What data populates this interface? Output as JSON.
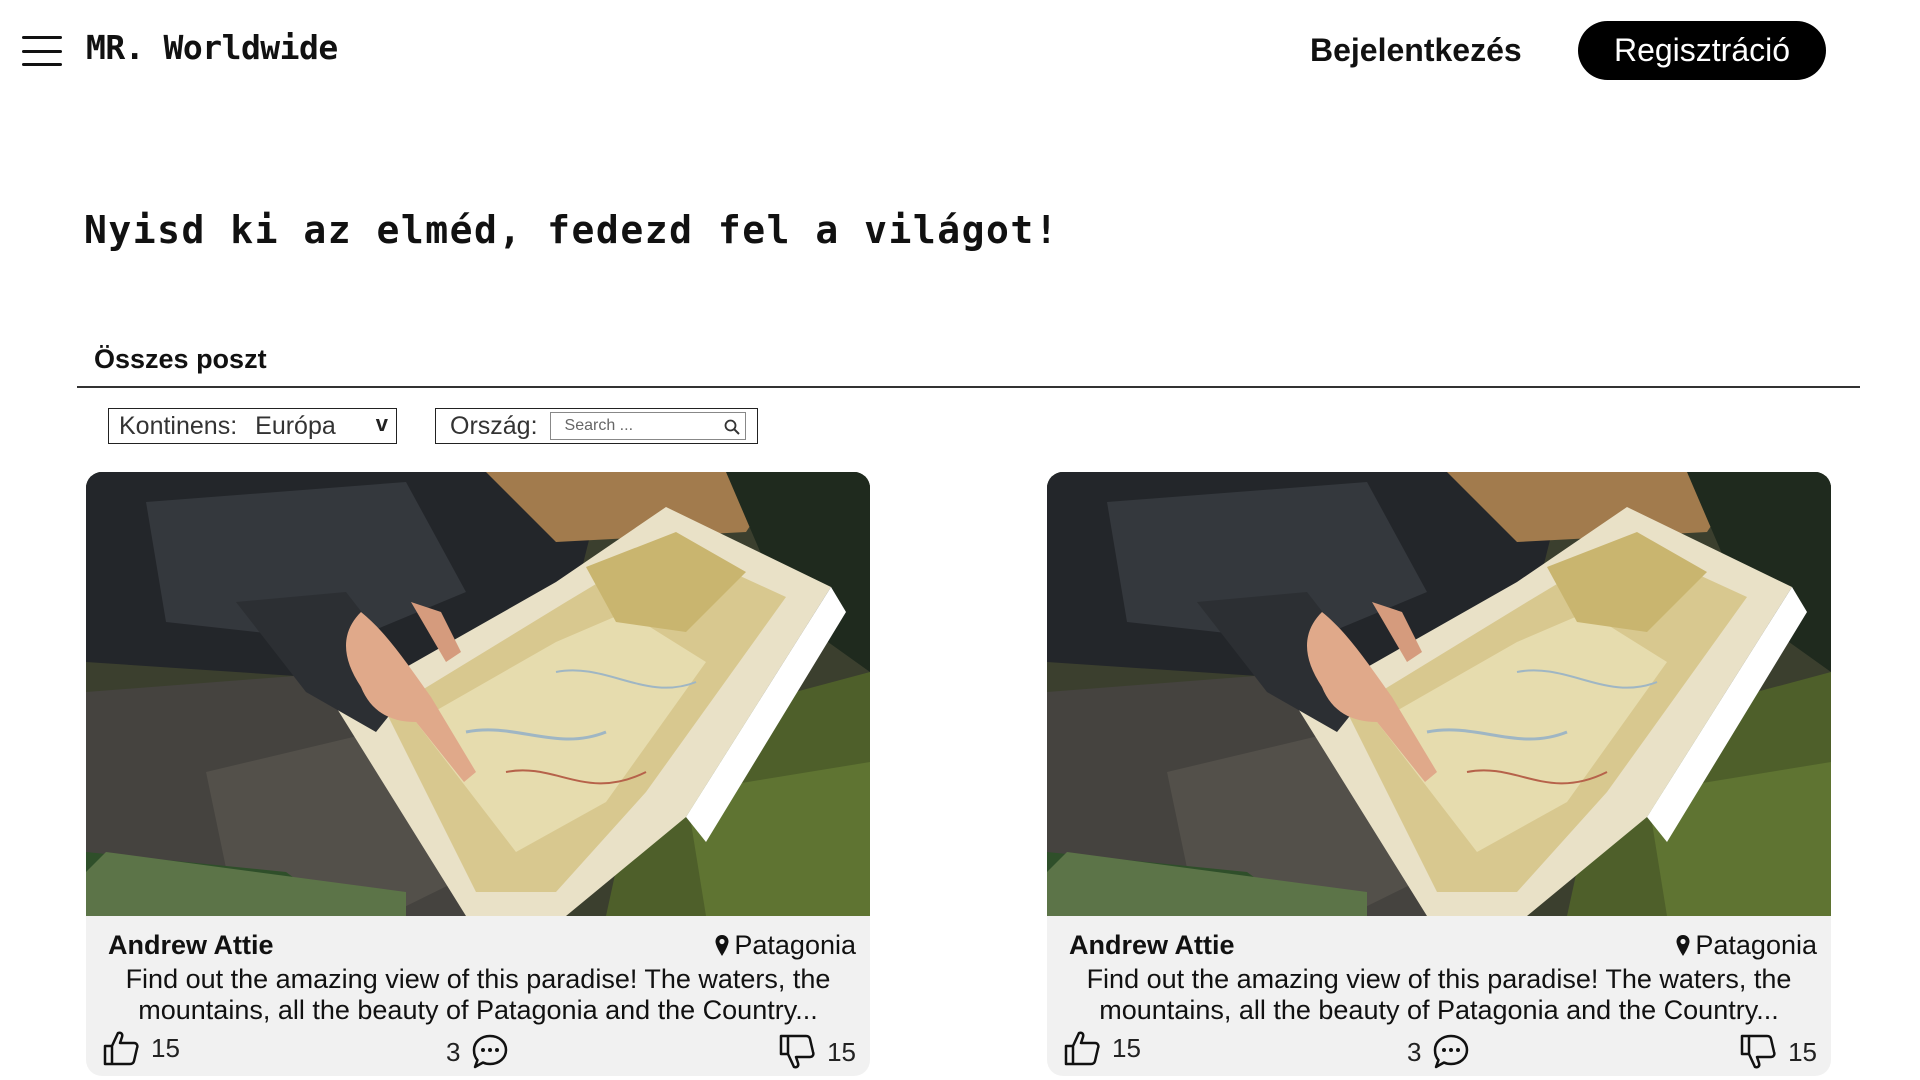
{
  "header": {
    "menu_icon": "hamburger-menu-icon",
    "logo": "MR. Worldwide",
    "login_label": "Bejelentkezés",
    "register_label": "Regisztráció"
  },
  "hero": {
    "title": "Nyisd ki az elméd, fedezd fel a világot!"
  },
  "section": {
    "title": "Összes poszt"
  },
  "filters": {
    "continent_label": "Kontinens:",
    "continent_value": "Európa",
    "continent_chevron": "v",
    "country_label": "Ország:",
    "country_placeholder": "Search ...",
    "search_icon": "search-icon"
  },
  "posts": [
    {
      "author": "Andrew Attie",
      "location": "Patagonia",
      "excerpt": "Find out the amazing view of this paradise! The waters, the mountains, all the beauty of Patagonia and the Country...",
      "likes": "15",
      "comments": "3",
      "dislikes": "15",
      "image": "person-reading-map-photo"
    },
    {
      "author": "Andrew Attie",
      "location": "Patagonia",
      "excerpt": "Find out the amazing view of this paradise! The waters, the mountains, all the beauty of Patagonia and the Country...",
      "likes": "15",
      "comments": "3",
      "dislikes": "15",
      "image": "person-reading-map-photo"
    }
  ],
  "colors": {
    "background": "#ffffff",
    "card_background": "#f1f1f1",
    "primary_button": "#000000",
    "text": "#111111"
  }
}
